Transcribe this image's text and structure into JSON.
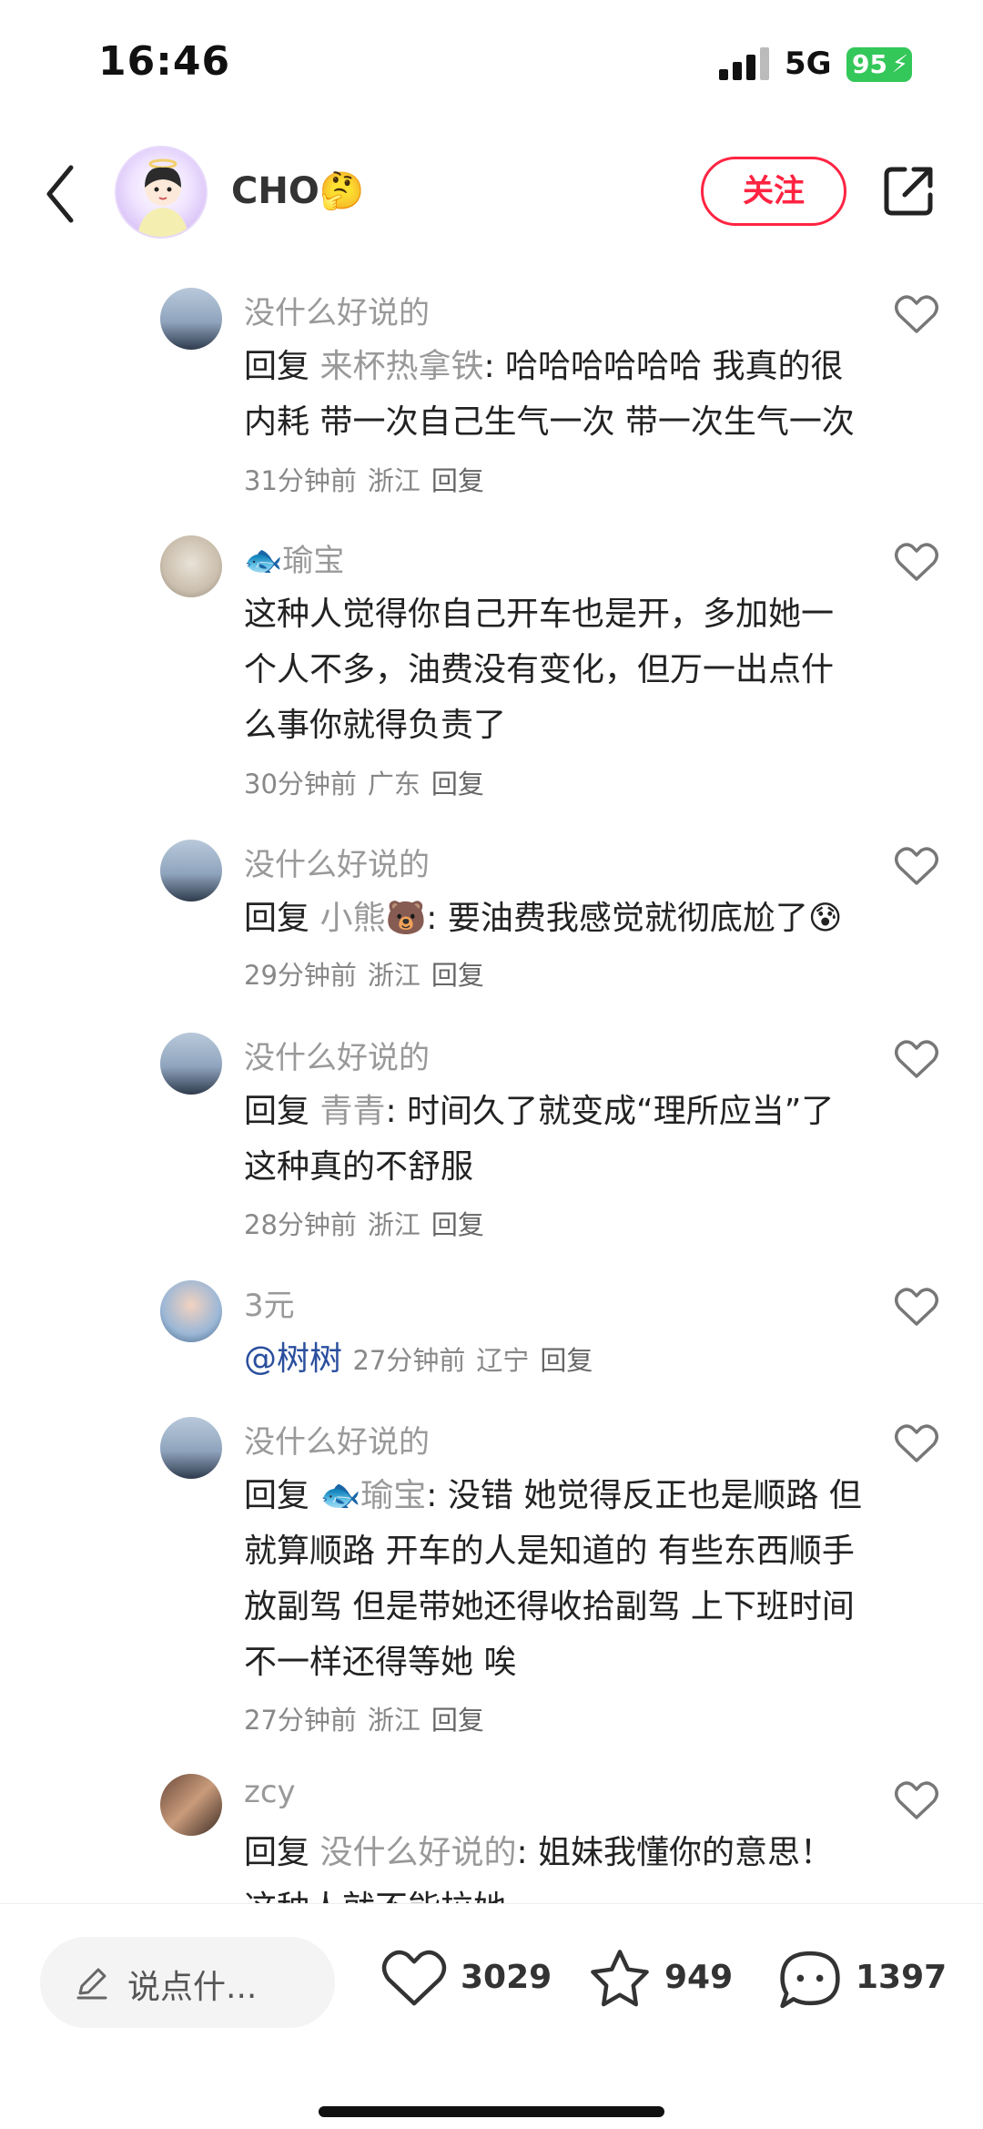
{
  "status_bar": {
    "time": "16:46",
    "network": "5G",
    "battery": "95"
  },
  "header": {
    "author_name": "CHO🤔",
    "follow_label": "关注"
  },
  "comments": [
    {
      "name": "没什么好说的",
      "reply_prefix": "回复",
      "reply_to": "来杯热拿铁",
      "text": ": 哈哈哈哈哈哈 我真的很内耗 带一次自己生气一次 带一次生气一次",
      "time": "31分钟前",
      "location": "浙江",
      "reply_label": "回复"
    },
    {
      "name": "🐟瑜宝",
      "text": "这种人觉得你自己开车也是开，多加她一个人不多，油费没有变化，但万一出点什么事你就得负责了",
      "time": "30分钟前",
      "location": "广东",
      "reply_label": "回复"
    },
    {
      "name": "没什么好说的",
      "reply_prefix": "回复",
      "reply_to": "小熊🐻",
      "text": ": 要油费我感觉就彻底尬了😰",
      "time": "29分钟前",
      "location": "浙江",
      "reply_label": "回复"
    },
    {
      "name": "没什么好说的",
      "reply_prefix": "回复",
      "reply_to": "青青",
      "text": ": 时间久了就变成“理所应当”了 这种真的不舒服",
      "time": "28分钟前",
      "location": "浙江",
      "reply_label": "回复"
    },
    {
      "name": "3元",
      "mention": "@树树",
      "time": "27分钟前",
      "location": "辽宁",
      "reply_label": "回复"
    },
    {
      "name": "没什么好说的",
      "reply_prefix": "回复",
      "reply_to": "🐟瑜宝",
      "text": ": 没错 她觉得反正也是顺路 但就算顺路 开车的人是知道的 有些东西顺手放副驾 但是带她还得收拾副驾 上下班时间不一样还得等她 唉",
      "time": "27分钟前",
      "location": "浙江",
      "reply_label": "回复"
    },
    {
      "name": "zcy",
      "reply_prefix": "回复",
      "reply_to": "没什么好说的",
      "text": ": 姐妹我懂你的意思！这种人就不能拉她"
    }
  ],
  "bottom_bar": {
    "input_placeholder": "说点什...",
    "likes": "3029",
    "favorites": "949",
    "comments": "1397"
  },
  "colors": {
    "accent": "#ff2442",
    "muted": "#999999",
    "mention": "#2b4f9e",
    "battery": "#34c759"
  }
}
